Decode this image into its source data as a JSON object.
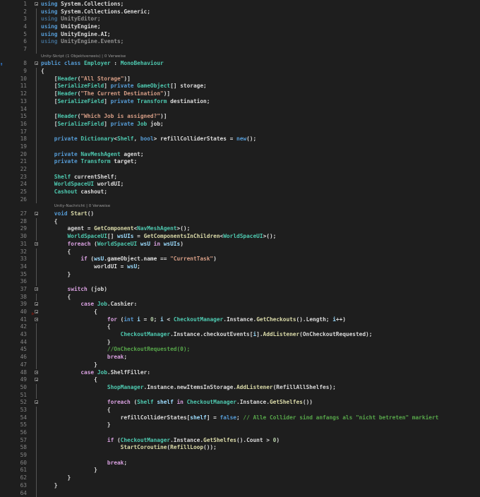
{
  "editor": {
    "gutter_marker": "↑",
    "colors": {
      "keyword": "#569cd6",
      "control": "#d8a0df",
      "type": "#4ec9b0",
      "method": "#dcdcaa",
      "string": "#d69d85",
      "comment": "#57a64a",
      "background": "#1e1e1e"
    },
    "lines": [
      {
        "n": "1",
        "f": 1,
        "t": [
          [
            "k",
            "using"
          ],
          [
            "p",
            " System.Collections;"
          ]
        ]
      },
      {
        "n": "2",
        "t": [
          [
            "k",
            "using"
          ],
          [
            "p",
            " System.Collections.Generic;"
          ]
        ]
      },
      {
        "n": "3",
        "t": [
          [
            "u",
            "using"
          ],
          [
            "ud",
            " UnityEditor;"
          ]
        ]
      },
      {
        "n": "4",
        "t": [
          [
            "k",
            "using"
          ],
          [
            "p",
            " UnityEngine;"
          ]
        ]
      },
      {
        "n": "5",
        "t": [
          [
            "k",
            "using"
          ],
          [
            "p",
            " UnityEngine.AI;"
          ]
        ]
      },
      {
        "n": "6",
        "t": [
          [
            "u",
            "using"
          ],
          [
            "ud",
            " UnityEngine.Events;"
          ]
        ]
      },
      {
        "n": "7",
        "t": []
      },
      {
        "lens": "Unity-Skript (1 Objektverweis) | 0 Verweise",
        "indent": 0
      },
      {
        "n": "8",
        "f": 1,
        "t": [
          [
            "k",
            "public class "
          ],
          [
            "t",
            "Employer"
          ],
          [
            "p",
            " : "
          ],
          [
            "t",
            "MonoBehaviour"
          ]
        ]
      },
      {
        "n": "9",
        "t": [
          [
            "p",
            "{"
          ]
        ]
      },
      {
        "n": "10",
        "t": [
          [
            "p",
            "    ["
          ],
          [
            "t",
            "Header"
          ],
          [
            "p",
            "("
          ],
          [
            "s",
            "\"All Storage\""
          ],
          [
            "p",
            ")]"
          ]
        ]
      },
      {
        "n": "11",
        "t": [
          [
            "p",
            "    ["
          ],
          [
            "t",
            "SerializeField"
          ],
          [
            "p",
            "] "
          ],
          [
            "k",
            "private "
          ],
          [
            "t",
            "GameObject"
          ],
          [
            "p",
            "[] storage;"
          ]
        ]
      },
      {
        "n": "12",
        "t": [
          [
            "p",
            "    ["
          ],
          [
            "t",
            "Header"
          ],
          [
            "p",
            "("
          ],
          [
            "s",
            "\"The Current Destination\""
          ],
          [
            "p",
            ")]"
          ]
        ]
      },
      {
        "n": "13",
        "t": [
          [
            "p",
            "    ["
          ],
          [
            "t",
            "SerializeField"
          ],
          [
            "p",
            "] "
          ],
          [
            "k",
            "private "
          ],
          [
            "t",
            "Transform"
          ],
          [
            "p",
            " destination;"
          ]
        ]
      },
      {
        "n": "14",
        "t": []
      },
      {
        "n": "15",
        "t": [
          [
            "p",
            "    ["
          ],
          [
            "t",
            "Header"
          ],
          [
            "p",
            "("
          ],
          [
            "s",
            "\"Which Job is assigned?\""
          ],
          [
            "p",
            ")]"
          ]
        ]
      },
      {
        "n": "16",
        "t": [
          [
            "p",
            "    ["
          ],
          [
            "t",
            "SerializeField"
          ],
          [
            "p",
            "] "
          ],
          [
            "k",
            "private "
          ],
          [
            "t",
            "Job"
          ],
          [
            "p",
            " job;"
          ]
        ]
      },
      {
        "n": "17",
        "t": []
      },
      {
        "n": "18",
        "t": [
          [
            "k",
            "    private "
          ],
          [
            "t",
            "Dictionary"
          ],
          [
            "p",
            "<"
          ],
          [
            "t",
            "Shelf"
          ],
          [
            "p",
            ", "
          ],
          [
            "k",
            "bool"
          ],
          [
            "p",
            "> refillColliderStates = "
          ],
          [
            "k",
            "new"
          ],
          [
            "p",
            "();"
          ]
        ]
      },
      {
        "n": "19",
        "t": []
      },
      {
        "n": "20",
        "t": [
          [
            "k",
            "    private "
          ],
          [
            "t",
            "NavMeshAgent"
          ],
          [
            "p",
            " agent;"
          ]
        ]
      },
      {
        "n": "21",
        "t": [
          [
            "k",
            "    private "
          ],
          [
            "t",
            "Transform"
          ],
          [
            "p",
            " target;"
          ]
        ]
      },
      {
        "n": "22",
        "t": []
      },
      {
        "n": "23",
        "t": [
          [
            "t",
            "    Shelf"
          ],
          [
            "p",
            " currentShelf;"
          ]
        ]
      },
      {
        "n": "24",
        "t": [
          [
            "t",
            "    WorldSpaceUI"
          ],
          [
            "p",
            " worldUI;"
          ]
        ]
      },
      {
        "n": "25",
        "t": [
          [
            "t",
            "    Cashout"
          ],
          [
            "p",
            " cashout;"
          ]
        ]
      },
      {
        "n": "26",
        "t": []
      },
      {
        "lens": "Unity-Nachricht | 0 Verweise",
        "indent": 1
      },
      {
        "n": "27",
        "f": 1,
        "t": [
          [
            "k",
            "    void "
          ],
          [
            "m",
            "Start"
          ],
          [
            "p",
            "()"
          ]
        ]
      },
      {
        "n": "28",
        "t": [
          [
            "p",
            "    {"
          ]
        ]
      },
      {
        "n": "29",
        "t": [
          [
            "p",
            "        agent = "
          ],
          [
            "m",
            "GetComponent"
          ],
          [
            "p",
            "<"
          ],
          [
            "t",
            "NavMeshAgent"
          ],
          [
            "p",
            ">();"
          ]
        ]
      },
      {
        "n": "30",
        "t": [
          [
            "t",
            "        WorldSpaceUI"
          ],
          [
            "p",
            "[] "
          ],
          [
            "v",
            "wsUIs"
          ],
          [
            "p",
            " = "
          ],
          [
            "m",
            "GetComponentsInChildren"
          ],
          [
            "p",
            "<"
          ],
          [
            "t",
            "WorldSpaceUI"
          ],
          [
            "p",
            ">();"
          ]
        ]
      },
      {
        "n": "31",
        "f": 1,
        "t": [
          [
            "c",
            "        foreach"
          ],
          [
            "p",
            " ("
          ],
          [
            "t",
            "WorldSpaceUI"
          ],
          [
            "v",
            " wsU"
          ],
          [
            "c",
            " in"
          ],
          [
            "v",
            " wsUIs"
          ],
          [
            "p",
            ")"
          ]
        ]
      },
      {
        "n": "32",
        "t": [
          [
            "p",
            "        {"
          ]
        ]
      },
      {
        "n": "33",
        "t": [
          [
            "c",
            "            if"
          ],
          [
            "p",
            " ("
          ],
          [
            "v",
            "wsU"
          ],
          [
            "p",
            ".gameObject.name == "
          ],
          [
            "s",
            "\"CurrentTask\""
          ],
          [
            "p",
            ")"
          ]
        ]
      },
      {
        "n": "34",
        "t": [
          [
            "p",
            "                worldUI = "
          ],
          [
            "v",
            "wsU"
          ],
          [
            "p",
            ";"
          ]
        ]
      },
      {
        "n": "35",
        "t": [
          [
            "p",
            "        }"
          ]
        ]
      },
      {
        "n": "36",
        "t": []
      },
      {
        "n": "37",
        "f": 1,
        "t": [
          [
            "c",
            "        switch"
          ],
          [
            "p",
            " (job)"
          ]
        ]
      },
      {
        "n": "38",
        "t": [
          [
            "p",
            "        {"
          ]
        ]
      },
      {
        "n": "39",
        "f": 1,
        "t": [
          [
            "c",
            "            case "
          ],
          [
            "t",
            "Job"
          ],
          [
            "p",
            ".Cashier:"
          ]
        ]
      },
      {
        "n": "40",
        "f": 1,
        "t": [
          [
            "p",
            "                {"
          ]
        ]
      },
      {
        "n": "41",
        "f": 1,
        "t": [
          [
            "c",
            "                    for"
          ],
          [
            "p",
            " ("
          ],
          [
            "k",
            "int "
          ],
          [
            "v",
            "i"
          ],
          [
            "p",
            " = "
          ],
          [
            "n",
            "0"
          ],
          [
            "p",
            "; "
          ],
          [
            "v",
            "i"
          ],
          [
            "p",
            " < "
          ],
          [
            "t",
            "CheckoutManager"
          ],
          [
            "p",
            ".Instance."
          ],
          [
            "m",
            "GetCheckouts"
          ],
          [
            "p",
            "().Length; "
          ],
          [
            "v",
            "i"
          ],
          [
            "p",
            "++)"
          ]
        ]
      },
      {
        "n": "42",
        "t": [
          [
            "p",
            "                    {"
          ]
        ]
      },
      {
        "n": "43",
        "t": [
          [
            "t",
            "                        CheckoutManager"
          ],
          [
            "p",
            ".Instance.checkoutEvents["
          ],
          [
            "v",
            "i"
          ],
          [
            "p",
            "]."
          ],
          [
            "m",
            "AddListener"
          ],
          [
            "p",
            "(OnCheckoutRequested);"
          ]
        ]
      },
      {
        "n": "44",
        "t": [
          [
            "p",
            "                    }"
          ]
        ]
      },
      {
        "n": "45",
        "t": [
          [
            "g",
            "                    //OnCheckoutRequested(0);"
          ]
        ]
      },
      {
        "n": "46",
        "t": [
          [
            "c",
            "                    break"
          ],
          [
            "p",
            ";"
          ]
        ]
      },
      {
        "n": "47",
        "t": [
          [
            "p",
            "                }"
          ]
        ]
      },
      {
        "n": "48",
        "f": 1,
        "t": [
          [
            "c",
            "            case "
          ],
          [
            "t",
            "Job"
          ],
          [
            "p",
            ".ShelfFiller:"
          ]
        ]
      },
      {
        "n": "49",
        "f": 1,
        "t": [
          [
            "p",
            "                {"
          ]
        ]
      },
      {
        "n": "50",
        "t": [
          [
            "t",
            "                    ShopManager"
          ],
          [
            "p",
            ".Instance.newItemsInStorage."
          ],
          [
            "m",
            "AddListener"
          ],
          [
            "p",
            "(RefillAllShelfes);"
          ]
        ]
      },
      {
        "n": "51",
        "t": []
      },
      {
        "n": "52",
        "f": 1,
        "t": [
          [
            "c",
            "                    foreach"
          ],
          [
            "p",
            " ("
          ],
          [
            "t",
            "Shelf"
          ],
          [
            "v",
            " shelf"
          ],
          [
            "c",
            " in "
          ],
          [
            "t",
            "CheckoutManager"
          ],
          [
            "p",
            ".Instance."
          ],
          [
            "m",
            "GetShelfes"
          ],
          [
            "p",
            "())"
          ]
        ]
      },
      {
        "n": "53",
        "t": [
          [
            "p",
            "                    {"
          ]
        ]
      },
      {
        "n": "54",
        "t": [
          [
            "p",
            "                        refillColliderStates["
          ],
          [
            "v",
            "shelf"
          ],
          [
            "p",
            "] = "
          ],
          [
            "k",
            "false"
          ],
          [
            "p",
            "; "
          ],
          [
            "g",
            "// Alle Collider sind anfangs als \"nicht betreten\" markiert"
          ]
        ]
      },
      {
        "n": "55",
        "t": [
          [
            "p",
            "                    }"
          ]
        ]
      },
      {
        "n": "56",
        "t": []
      },
      {
        "n": "57",
        "t": [
          [
            "c",
            "                    if"
          ],
          [
            "p",
            " ("
          ],
          [
            "t",
            "CheckoutManager"
          ],
          [
            "p",
            ".Instance."
          ],
          [
            "m",
            "GetShelfes"
          ],
          [
            "p",
            "().Count > "
          ],
          [
            "n",
            "0"
          ],
          [
            "p",
            ")"
          ]
        ]
      },
      {
        "n": "58",
        "t": [
          [
            "m",
            "                        StartCoroutine"
          ],
          [
            "p",
            "("
          ],
          [
            "m",
            "RefillLoop"
          ],
          [
            "p",
            "());"
          ]
        ]
      },
      {
        "n": "59",
        "t": []
      },
      {
        "n": "60",
        "t": [
          [
            "c",
            "                    break"
          ],
          [
            "p",
            ";"
          ]
        ]
      },
      {
        "n": "61",
        "t": [
          [
            "p",
            "                }"
          ]
        ]
      },
      {
        "n": "62",
        "t": [
          [
            "p",
            "        }"
          ]
        ]
      },
      {
        "n": "63",
        "t": [
          [
            "p",
            "    }"
          ]
        ]
      },
      {
        "n": "64",
        "t": []
      }
    ]
  }
}
